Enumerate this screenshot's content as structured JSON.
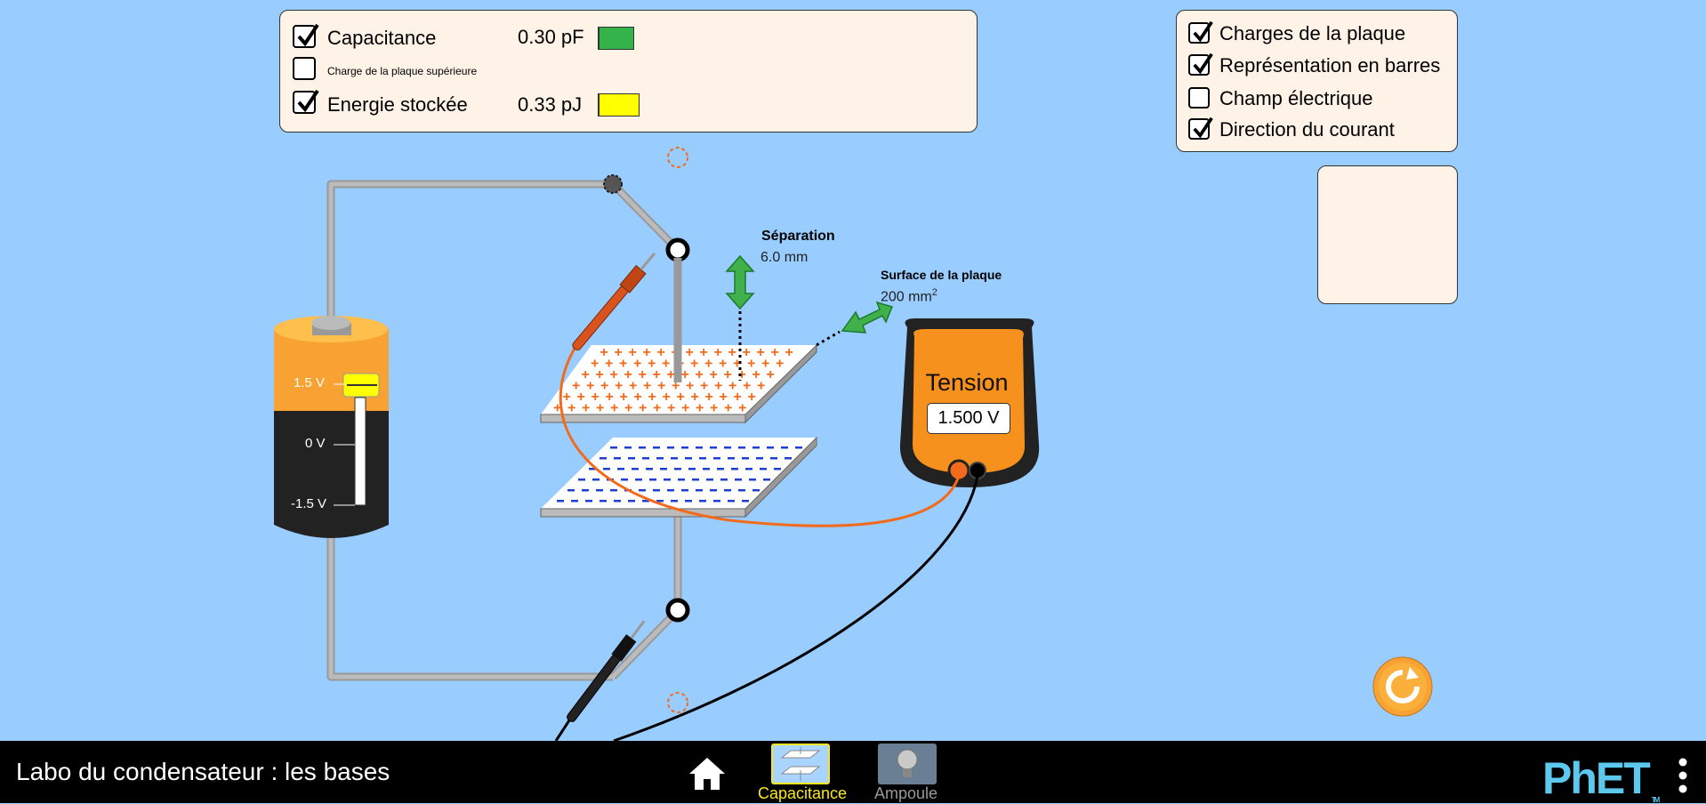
{
  "graphs": {
    "capacitance": {
      "label": "Capacitance",
      "checked": true,
      "value": "0.30 pF",
      "color": "#34b34a"
    },
    "top_plate_charge": {
      "label": "Charge de la plaque supérieure",
      "checked": false
    },
    "stored_energy": {
      "label": "Energie stockée",
      "checked": true,
      "value": "0.33 pJ",
      "color": "#ffff00"
    }
  },
  "view_options": [
    {
      "label": "Charges de la plaque",
      "checked": true
    },
    {
      "label": "Représentation en barres",
      "checked": true
    },
    {
      "label": "Champ électrique",
      "checked": false
    },
    {
      "label": "Direction du courant",
      "checked": true
    }
  ],
  "separation": {
    "title": "Séparation",
    "value": "6.0 mm"
  },
  "plate_area": {
    "title": "Surface de la plaque",
    "value": "200 mm",
    "unit_exponent": "2"
  },
  "battery": {
    "labels": [
      "1.5 V",
      "0 V",
      "-1.5 V"
    ],
    "voltage_fraction": 1.0
  },
  "voltmeter": {
    "title": "Tension",
    "reading": "1.500 V"
  },
  "navbar": {
    "sim_title": "Labo du condensateur : les bases",
    "screens": [
      {
        "label": "Capacitance",
        "active": true
      },
      {
        "label": "Ampoule",
        "active": false
      }
    ],
    "logo": "PhET",
    "logo_tm": "TM"
  },
  "colors": {
    "background": "#99ccff",
    "panel": "#fff3e8",
    "battery_top": "#f7a233",
    "battery_bottom": "#222222",
    "meter_body": "#f7911e",
    "positive_charge": "#f06a1c",
    "negative_charge": "#1f3fd1",
    "arrow": "#3fb04a",
    "active_tab": "#f8e71c",
    "logo": "#5dc8ee"
  }
}
